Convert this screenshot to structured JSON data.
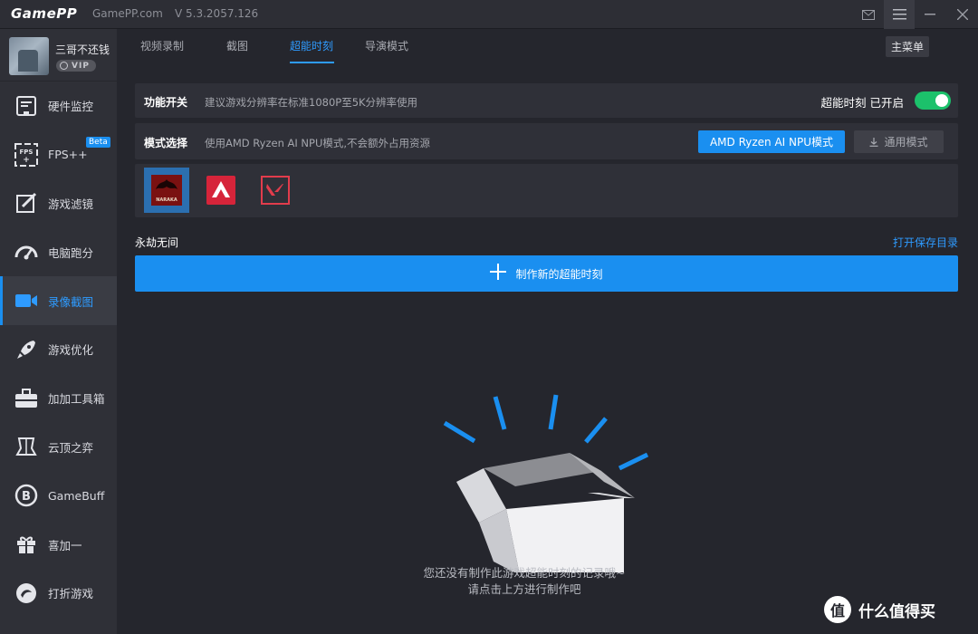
{
  "titlebar": {
    "logo": "GamePP",
    "site": "GamePP.com",
    "version": "V 5.3.2057.126",
    "tooltip": "主菜单"
  },
  "profile": {
    "username": "三哥不还钱",
    "badge": "VIP"
  },
  "sidebar": {
    "items": [
      {
        "label": "硬件监控",
        "icon": "hardware-monitor-icon"
      },
      {
        "label": "FPS++",
        "icon": "fps-icon",
        "badge": "Beta"
      },
      {
        "label": "游戏滤镜",
        "icon": "game-filter-icon"
      },
      {
        "label": "电脑跑分",
        "icon": "benchmark-gauge-icon"
      },
      {
        "label": "录像截图",
        "icon": "video-camera-icon",
        "active": true
      },
      {
        "label": "游戏优化",
        "icon": "rocket-icon"
      },
      {
        "label": "加加工具箱",
        "icon": "toolbox-icon"
      },
      {
        "label": "云顶之弈",
        "icon": "tft-icon"
      },
      {
        "label": "GameBuff",
        "icon": "gamebuff-icon"
      },
      {
        "label": "喜加一",
        "icon": "gift-icon"
      },
      {
        "label": "打折游戏",
        "icon": "discount-icon"
      }
    ]
  },
  "tabs": [
    "视频录制",
    "截图",
    "超能时刻",
    "导演模式"
  ],
  "active_tab": "超能时刻",
  "settings": {
    "switch_label": "功能开关",
    "switch_desc": "建议游戏分辨率在标准1080P至5K分辨率使用",
    "switch_status": "超能时刻 已开启",
    "switch_on": true,
    "mode_label": "模式选择",
    "mode_desc": "使用AMD Ryzen AI NPU模式,不会额外占用资源",
    "mode_amd": "AMD Ryzen AI NPU模式",
    "mode_general": "通用模式"
  },
  "games": [
    {
      "name": "naraka",
      "label": "NARAKA"
    },
    {
      "name": "apex",
      "label": ""
    },
    {
      "name": "valorant",
      "label": ""
    }
  ],
  "section": {
    "title": "永劫无间",
    "open_dir": "打开保存目录",
    "create": "制作新的超能时刻"
  },
  "empty": {
    "line1": "您还没有制作此游戏超能时刻的记录哦~",
    "line2": "请点击上方进行制作吧"
  },
  "watermark": {
    "text": "什么值得买",
    "badge": "值"
  },
  "colors": {
    "accent": "#1a8ff0",
    "toggle_on": "#1cc16b",
    "background": "#25262d",
    "sidebar": "#2f3037"
  }
}
